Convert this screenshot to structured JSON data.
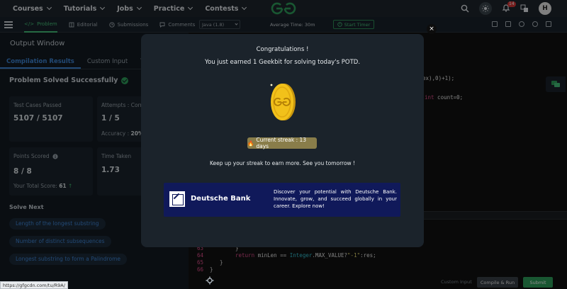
{
  "nav": {
    "items": [
      "Courses",
      "Tutorials",
      "Jobs",
      "Practice",
      "Contests"
    ],
    "notification_count": "14",
    "avatar_letter": "H"
  },
  "toolbar": {
    "tabs": [
      {
        "label": "Problem",
        "icon": "code-icon"
      },
      {
        "label": "Editorial",
        "icon": "book-icon"
      },
      {
        "label": "Submissions",
        "icon": "clock-icon"
      },
      {
        "label": "Comments",
        "icon": "comment-icon"
      }
    ],
    "language": "Java (1.8)",
    "average_time": "Average Time: 30m",
    "timer_label": "Start Timer"
  },
  "left_panel": {
    "title": "Output Window",
    "tabs": [
      "Compilation Results",
      "Custom Input",
      "Y.O.G.I."
    ],
    "status": "Problem Solved Successfully",
    "stats": {
      "test_cases_label": "Test Cases Passed",
      "test_cases_value": "5107 / 5107",
      "attempts_label": "Attempts : Corre",
      "attempts_value": "1 / 5",
      "accuracy_label": "Accuracy :",
      "accuracy_value": "20%",
      "points_label": "Points Scored",
      "points_value": "8 / 8",
      "total_score_label": "Your Total Score:",
      "total_score_value": "61",
      "time_label": "Time Taken",
      "time_value": "1.73"
    },
    "solve_next_title": "Solve Next",
    "solve_next": [
      "Length of the longest substring",
      "Number of distinct subsequences",
      "Longest substring to form a Palindrome"
    ]
  },
  "editor": {
    "line_frag_1": "ex),0)+1);",
    "line_frag_2_kw": "int",
    "line_frag_2_rest": " count=0;",
    "line_numbers": [
      "63",
      "64",
      "65",
      "66"
    ],
    "line_63": "}",
    "line_64_kw": "return",
    "line_64_a": " minLen == ",
    "line_64_type": "Integer",
    "line_64_b": ".MAX_VALUE?",
    "line_64_str": "\"-1\"",
    "line_64_c": ":res;",
    "line_65": "}",
    "line_66": "}",
    "custom_input": "Custom Input",
    "compile_run": "Compile & Run",
    "submit": "Submit"
  },
  "modal": {
    "close": "×",
    "title": "Congratulations !",
    "message": "You just earned 1 Geekbit for solving today's POTD.",
    "streak": "Current streak : 13 days",
    "keep_up": "Keep up your streak to earn more. See you tomorrow !",
    "ad": {
      "brand": "Deutsche Bank",
      "text": "Discover your potential with Deutsche Bank. Innovate, grow, and succeed globally in your career. Explore now!"
    }
  },
  "status_url": "https://gfgcdn.com/tu/R9A/",
  "colors": {
    "accent_green": "#2f9e5b",
    "accent_blue": "#3f86d6",
    "ad_navy": "#10195a",
    "coin_gold": "#f2c11a"
  }
}
